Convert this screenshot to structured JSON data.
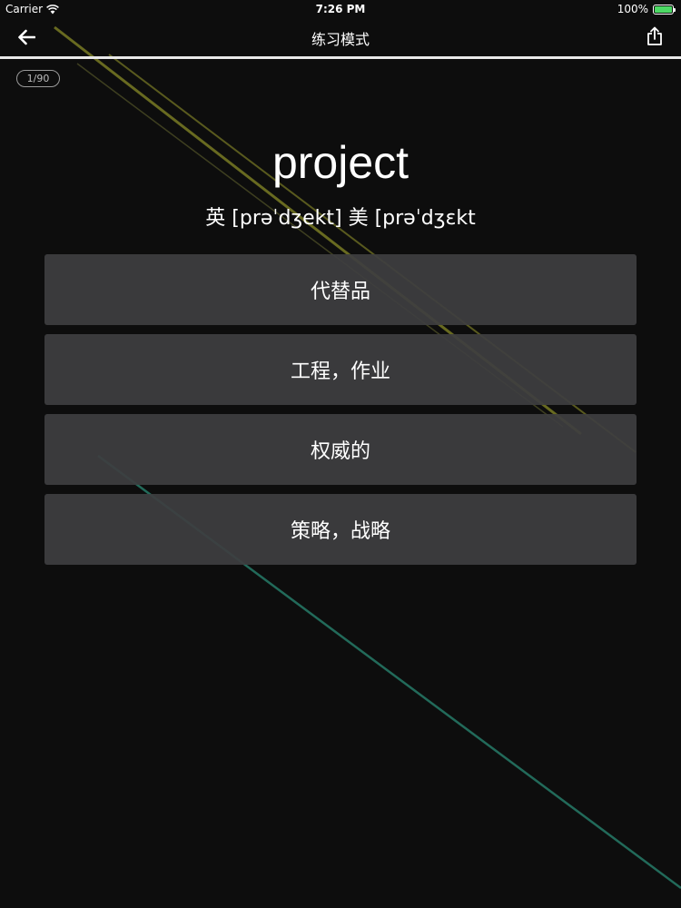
{
  "status_bar": {
    "carrier": "Carrier",
    "time": "7:26 PM",
    "battery": "100%",
    "battery_level": 1.0,
    "battery_color": "#4cd964"
  },
  "nav": {
    "back_icon": "arrow-left-icon",
    "title": "练习模式",
    "share_icon": "share-icon"
  },
  "progress": {
    "label": "1/90"
  },
  "word": {
    "text": "project",
    "phonetic": "英 [prəˈdʒekt] 美 [prəˈdʒɛkt"
  },
  "options": [
    {
      "label": "代替品"
    },
    {
      "label": "工程，作业"
    },
    {
      "label": "权威的"
    },
    {
      "label": "策略，战略"
    }
  ],
  "theme": {
    "background": "#0d0d0d",
    "option_background": "#3e3e40",
    "streak_yellow": "#b5b832",
    "streak_teal": "#2a8a74"
  }
}
